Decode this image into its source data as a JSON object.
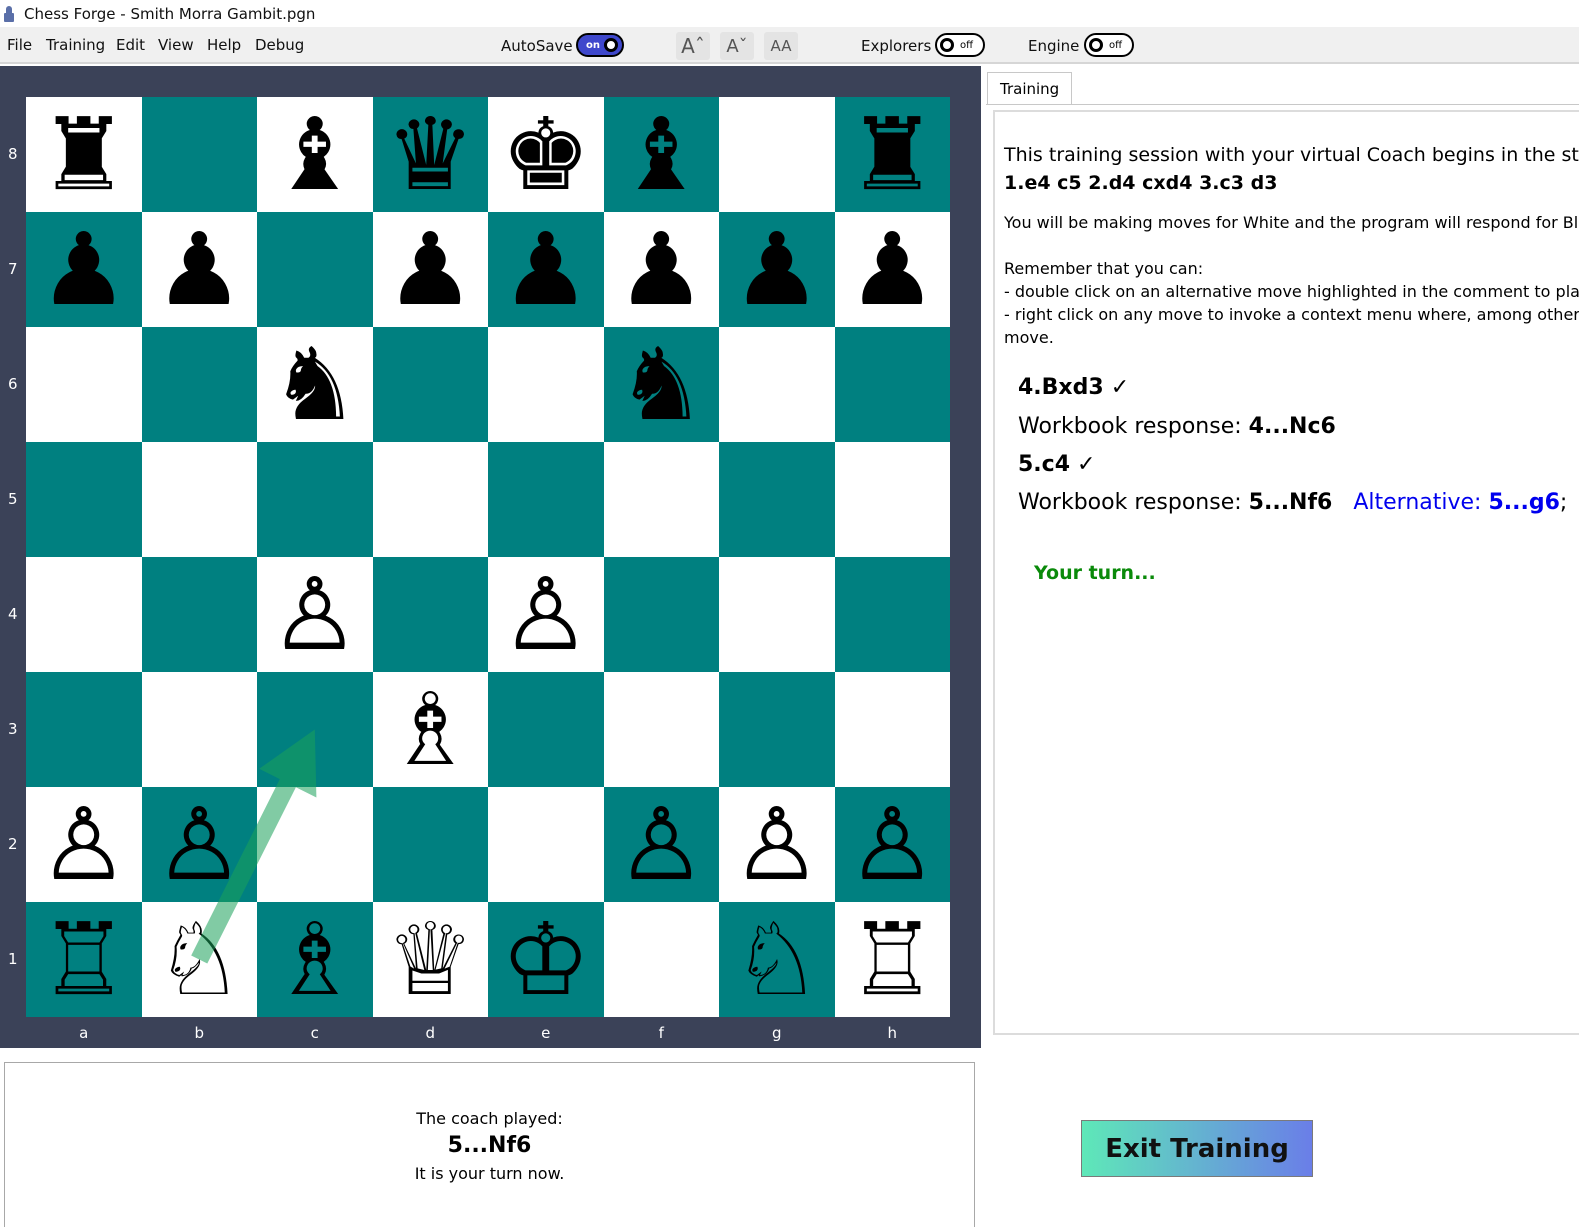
{
  "window": {
    "title": "Chess Forge - Smith Morra Gambit.pgn"
  },
  "menu": {
    "items": [
      "File",
      "Training",
      "Edit",
      "View",
      "Help",
      "Debug"
    ]
  },
  "toolbar": {
    "autosave_label": "AutoSave",
    "autosave_state": "on",
    "font_increase": "Aˆ",
    "font_decrease": "Aˇ",
    "font_fixed": "AA",
    "explorers_label": "Explorers",
    "explorers_state": "off",
    "engine_label": "Engine",
    "engine_state": "off"
  },
  "board": {
    "colors": {
      "light": "#ffffff",
      "dark": "#008080",
      "frame": "#3b4258"
    },
    "ranks": [
      "8",
      "7",
      "6",
      "5",
      "4",
      "3",
      "2",
      "1"
    ],
    "files": [
      "a",
      "b",
      "c",
      "d",
      "e",
      "f",
      "g",
      "h"
    ],
    "position": [
      [
        "♜",
        "",
        "♝",
        "♛",
        "♚",
        "♝",
        "",
        "♜"
      ],
      [
        "♟",
        "♟",
        "",
        "♟",
        "♟",
        "♟",
        "♟",
        "♟"
      ],
      [
        "",
        "",
        "♞",
        "",
        "",
        "♞",
        "",
        ""
      ],
      [
        "",
        "",
        "",
        "",
        "",
        "",
        "",
        ""
      ],
      [
        "",
        "",
        "♙",
        "",
        "♙",
        "",
        "",
        ""
      ],
      [
        "",
        "",
        "",
        "♗",
        "",
        "",
        "",
        ""
      ],
      [
        "♙",
        "♙",
        "",
        "",
        "",
        "♙",
        "♙",
        "♙"
      ],
      [
        "♖",
        "♘",
        "♗",
        "♕",
        "♔",
        "",
        "♘",
        "♖"
      ]
    ],
    "arrow": {
      "from": "b1",
      "to": "c3",
      "color": "#1aa15a"
    }
  },
  "training_panel": {
    "tab_label": "Training",
    "intro_line1": "This training session with your virtual Coach begins in the startin",
    "intro_moves": "1.e4 c5 2.d4 cxd4 3.c3 d3",
    "intro_line2": "You will be making moves for White and the program will respond for Blac",
    "remember": "Remember that you can:",
    "tip1": "- double click on an alternative move highlighted in the comment to play",
    "tip2": "- right click on any move to invoke a context menu where, among other op",
    "tip2_cont": "move.",
    "moves": [
      {
        "move": "4.Bxd3",
        "check": "✓"
      },
      {
        "response_label": "Workbook response:",
        "response": "4...Nc6"
      },
      {
        "move": "5.c4",
        "check": "✓"
      },
      {
        "response_label": "Workbook response:",
        "response": "5...Nf6",
        "alt_label": "Alternative:",
        "alt_move": "5...g6",
        "alt_suffix": ";"
      }
    ],
    "your_turn": "Your turn..."
  },
  "message_box": {
    "line1": "The coach played:",
    "line2": "5...Nf6",
    "line3": "It is your turn now."
  },
  "exit_button": {
    "label": "Exit Training"
  }
}
